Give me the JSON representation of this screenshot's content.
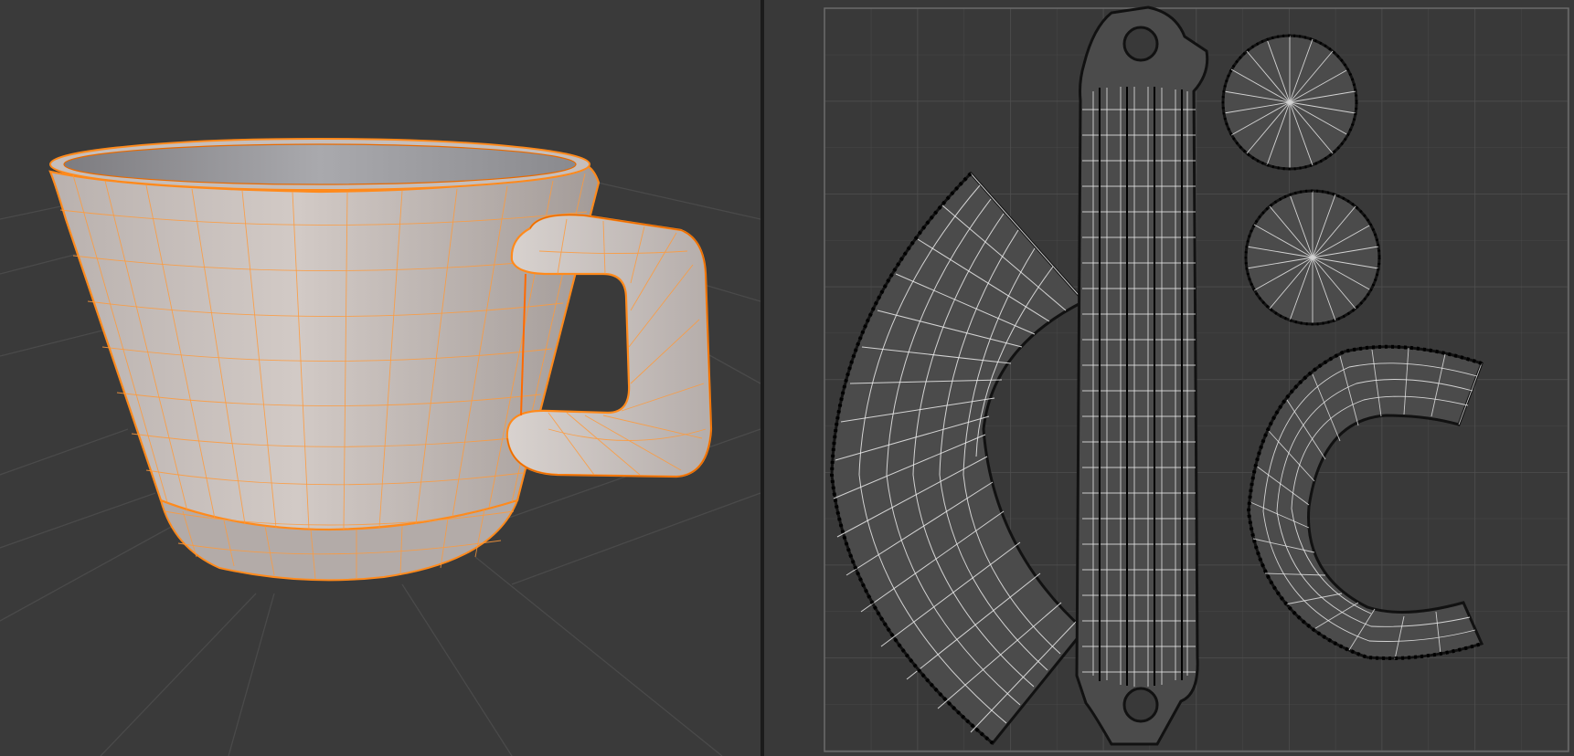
{
  "workspace": {
    "panes": [
      {
        "id": "viewport-3d",
        "object": "cup",
        "mode": "edit",
        "overlay": "wireframe",
        "selected": true
      },
      {
        "id": "uv-editor",
        "islands": [
          "cup-side-strip",
          "handle-strip",
          "bottom-cap",
          "inner-cap",
          "rim-ring"
        ]
      }
    ]
  },
  "colors": {
    "background_3d": "#3a3a3a",
    "background_uv": "#393939",
    "selection": "#ff8a1c",
    "selection_dark": "#e86a00",
    "mesh_surface": "#c8c0bc",
    "uv_face": "#4a4a4a",
    "uv_edge": "#f2f2f2",
    "uv_vertex": "#0a0a0a",
    "grid": "#4c4c4c"
  }
}
